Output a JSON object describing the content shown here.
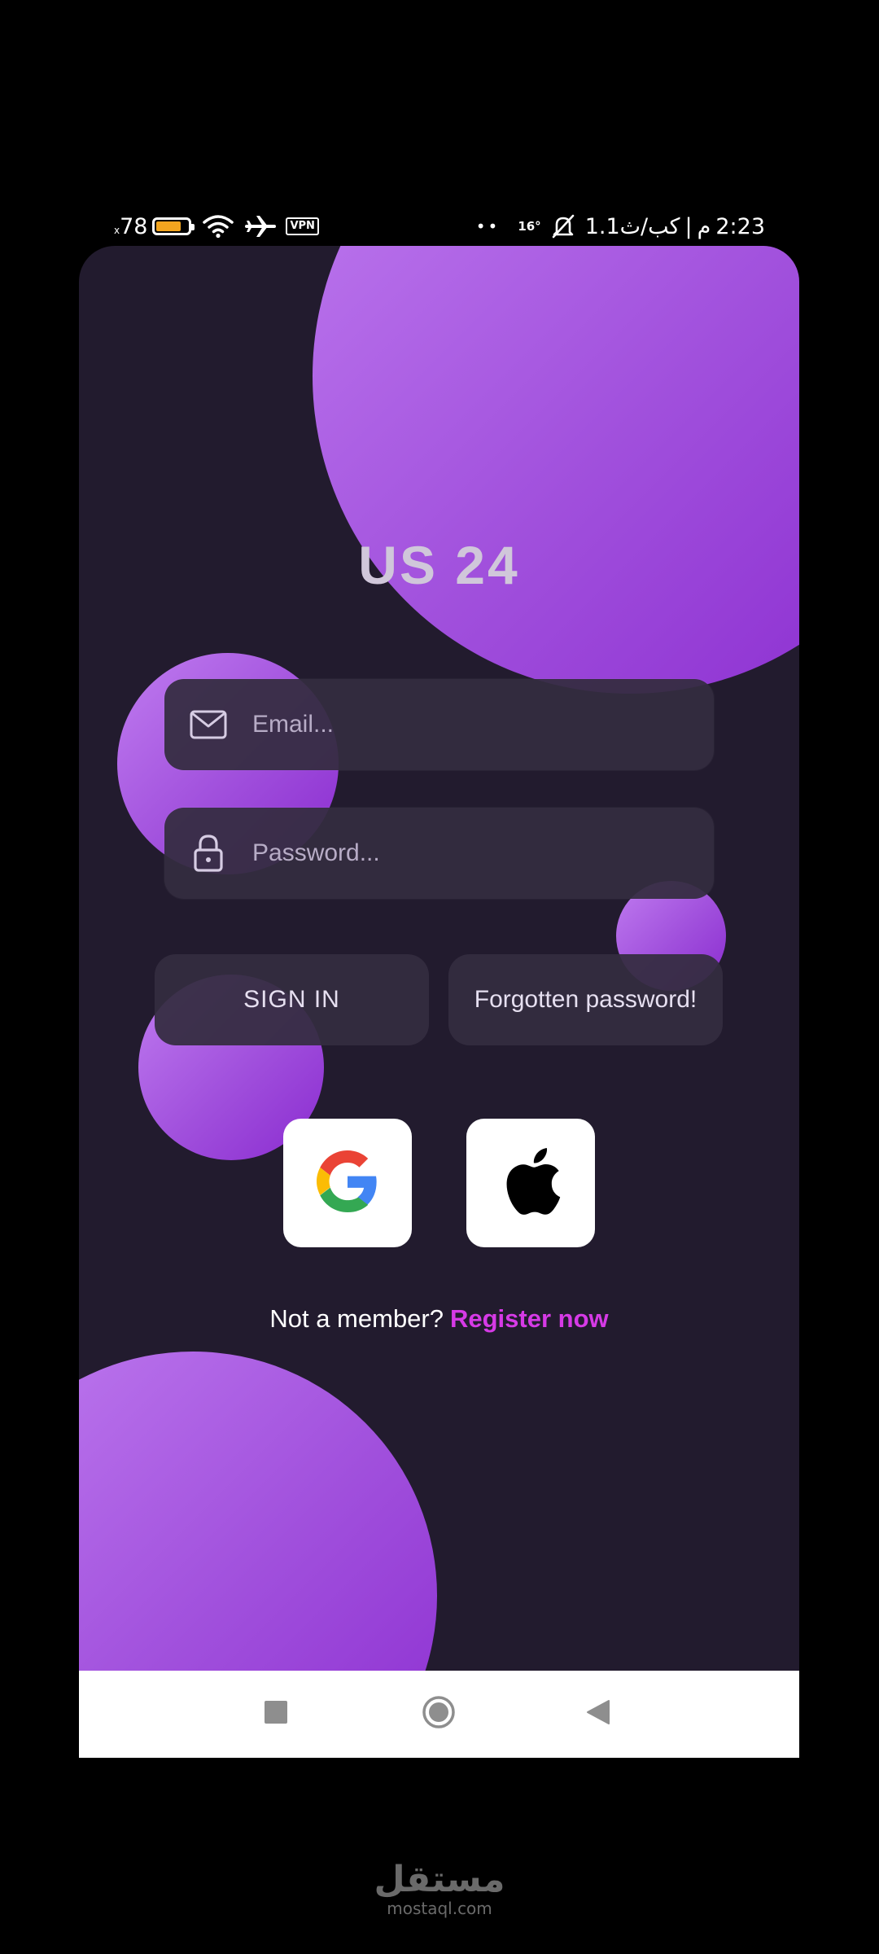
{
  "status_bar": {
    "battery_level": "78",
    "battery_suffix": "x",
    "battery_fraction": 0.78,
    "vpn_label": "VPN",
    "dots": "••",
    "temperature": "16°",
    "data_speed": "1.1كب/ث",
    "separator": "|",
    "ampm": "م",
    "time": "2:23",
    "icons": [
      "battery-icon",
      "wifi-icon",
      "airplane-icon",
      "vpn-icon",
      "mute-icon"
    ]
  },
  "app": {
    "title": "US 24"
  },
  "form": {
    "email_placeholder": "Email...",
    "password_placeholder": "Password...",
    "email_icon": "mail-icon",
    "password_icon": "lock-icon"
  },
  "buttons": {
    "sign_in": "SIGN IN",
    "forgot": "Forgotten password!"
  },
  "social": {
    "google_icon": "google-icon",
    "apple_icon": "apple-icon"
  },
  "register": {
    "prompt": "Not a member?",
    "link": "Register now"
  },
  "nav": {
    "icons": [
      "recents-icon",
      "home-icon",
      "back-icon"
    ]
  },
  "watermark": {
    "arabic": "مستقل",
    "latin": "mostaql.com"
  },
  "colors": {
    "background": "#221b2e",
    "accent": "#d63ae6",
    "blob_light": "#c07cf0",
    "blob_dark": "#8a2bd0",
    "field": "#342c40"
  }
}
